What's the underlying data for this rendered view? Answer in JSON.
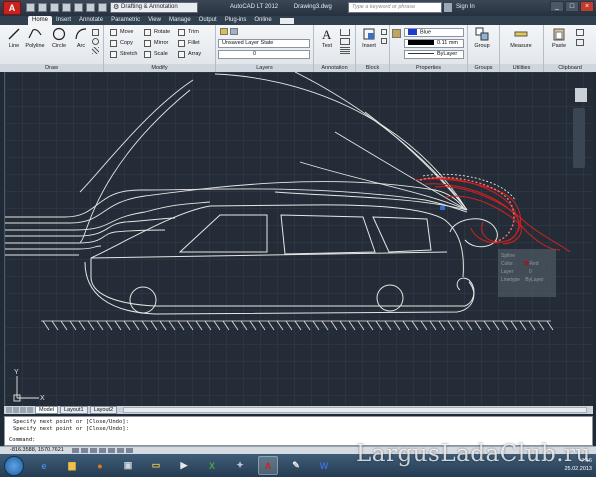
{
  "titlebar": {
    "app_button_label": "A",
    "workspace": "Drafting & Annotation",
    "app_title": "AutoCAD LT 2012",
    "file_name": "Drawing3.dwg",
    "search_placeholder": "Type a keyword or phrase",
    "sign_in": "Sign In"
  },
  "tabs": [
    "Home",
    "Insert",
    "Annotate",
    "Parametric",
    "View",
    "Manage",
    "Output",
    "Plug-ins",
    "Online"
  ],
  "active_tab": "Home",
  "ribbon": {
    "draw": {
      "title": "Draw",
      "line": "Line",
      "polyline": "Polyline",
      "circle": "Circle",
      "arc": "Arc"
    },
    "modify": {
      "title": "Modify",
      "move": "Move",
      "rotate": "Rotate",
      "trim": "Trim",
      "copy": "Copy",
      "mirror": "Mirror",
      "fillet": "Fillet",
      "stretch": "Stretch",
      "scale": "Scale",
      "array": "Array"
    },
    "layers": {
      "title": "Layers",
      "layer_state": "Unsaved Layer State",
      "current_layer": "0"
    },
    "annotation": {
      "title": "Annotation",
      "text": "Text"
    },
    "block": {
      "title": "Block",
      "insert": "Insert"
    },
    "properties": {
      "title": "Properties",
      "color": "Blue",
      "lineweight": "0.11 mm",
      "linetype": "ByLayer"
    },
    "groups": {
      "title": "Groups",
      "group": "Group"
    },
    "utilities": {
      "title": "Utilities",
      "measure": "Measure"
    },
    "clipboard": {
      "title": "Clipboard",
      "paste": "Paste"
    }
  },
  "canvas": {
    "ucs_y": "Y",
    "ucs_x": "X",
    "properties_overlay": [
      "Spline",
      "Color",
      "Red",
      "Layer",
      "0",
      "Linetype",
      "ByLayer"
    ]
  },
  "layout_tabs": [
    "Model",
    "Layout1",
    "Layout2"
  ],
  "active_layout": "Model",
  "command_line": {
    "history": [
      "Specify next point or [Close/Undo]:",
      "Specify next point or [Close/Undo]:"
    ],
    "prompt": "Command:"
  },
  "status": {
    "coordinates": "-816.3588, 1570.7621"
  },
  "taskbar": {
    "time": "7:16",
    "date": "25.02.2013"
  },
  "watermark": "LargusLadaClub.ru",
  "colors": {
    "accent_red": "#d22020",
    "drawing_line": "#e6e6e6",
    "canvas_bg": "#242d37",
    "layer_blue": "#1a3bd6"
  }
}
